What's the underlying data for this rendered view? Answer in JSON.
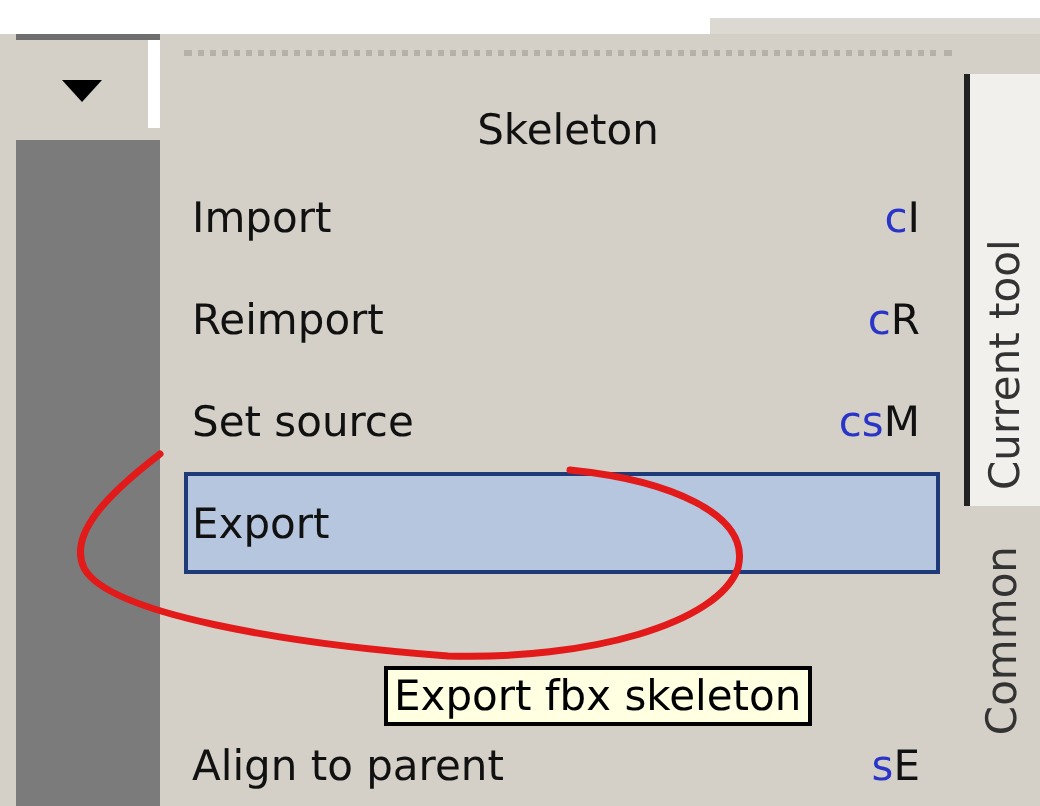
{
  "panel": {
    "title": "Skeleton"
  },
  "items": [
    {
      "label": "Import",
      "shortcut": {
        "modifiers": "c",
        "key": "I"
      },
      "selected": false
    },
    {
      "label": "Reimport",
      "shortcut": {
        "modifiers": "c",
        "key": "R"
      },
      "selected": false
    },
    {
      "label": "Set source",
      "shortcut": {
        "modifiers": "cs",
        "key": "M"
      },
      "selected": false
    },
    {
      "label": "Export",
      "selected": true
    },
    {
      "label": "Align to parent",
      "shortcut": {
        "modifiers": "s",
        "key": "E"
      },
      "selected": false
    }
  ],
  "tooltip": "Export fbx skeleton",
  "tabs": [
    {
      "label": "Current tool",
      "selected": true
    },
    {
      "label": "Common",
      "selected": false
    }
  ]
}
